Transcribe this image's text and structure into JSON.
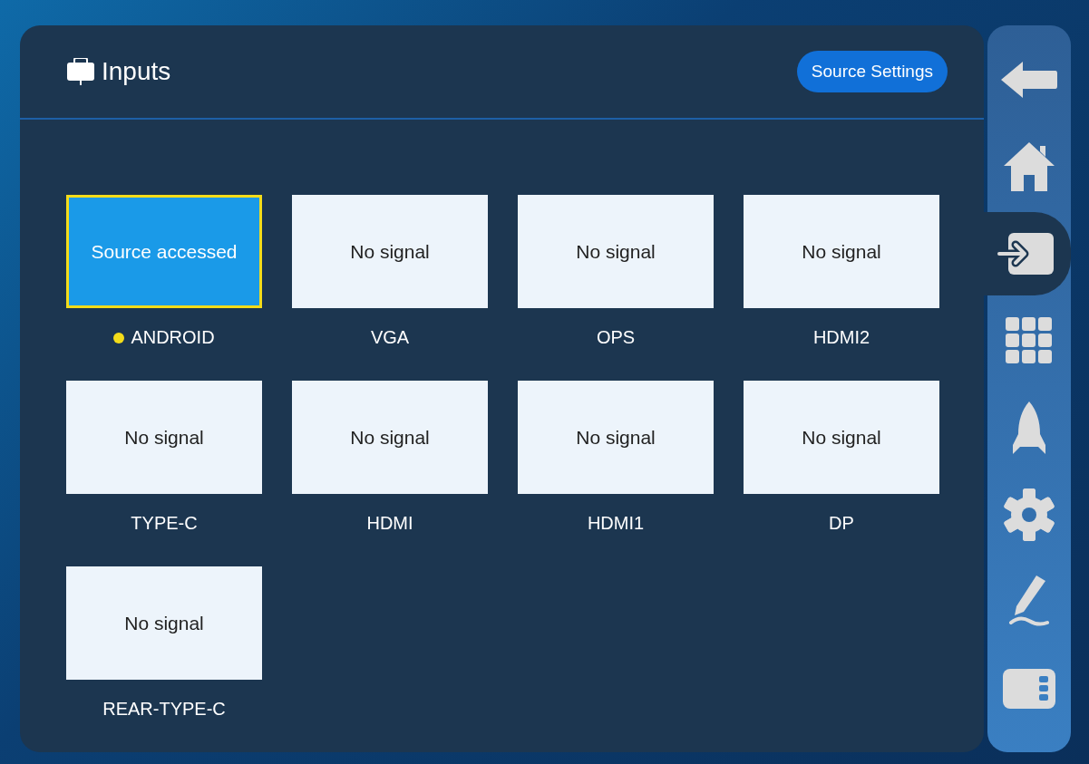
{
  "header": {
    "title": "Inputs",
    "button": "Source Settings"
  },
  "inputs": [
    {
      "label": "ANDROID",
      "status": "Source accessed",
      "selected": true,
      "current": true
    },
    {
      "label": "VGA",
      "status": "No signal",
      "selected": false,
      "current": false
    },
    {
      "label": "OPS",
      "status": "No signal",
      "selected": false,
      "current": false
    },
    {
      "label": "HDMI2",
      "status": "No signal",
      "selected": false,
      "current": false
    },
    {
      "label": "TYPE-C",
      "status": "No signal",
      "selected": false,
      "current": false
    },
    {
      "label": "HDMI",
      "status": "No signal",
      "selected": false,
      "current": false
    },
    {
      "label": "HDMI1",
      "status": "No signal",
      "selected": false,
      "current": false
    },
    {
      "label": "DP",
      "status": "No signal",
      "selected": false,
      "current": false
    },
    {
      "label": "REAR-TYPE-C",
      "status": "No signal",
      "selected": false,
      "current": false
    }
  ],
  "sidebar": {
    "items": [
      {
        "kind": "back",
        "selected": false
      },
      {
        "kind": "home",
        "selected": false
      },
      {
        "kind": "input",
        "selected": true
      },
      {
        "kind": "apps",
        "selected": false
      },
      {
        "kind": "rocket",
        "selected": false
      },
      {
        "kind": "settings",
        "selected": false
      },
      {
        "kind": "pen",
        "selected": false
      },
      {
        "kind": "panel",
        "selected": false
      }
    ]
  }
}
